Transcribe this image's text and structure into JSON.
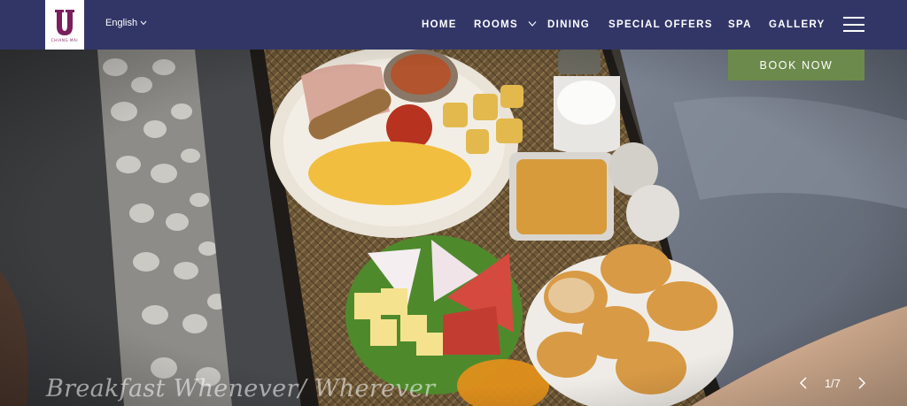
{
  "header": {
    "logo_subtext": "CHIANG MAI",
    "language": "English",
    "nav": {
      "home": "HOME",
      "rooms": "ROOMS",
      "dining": "DINING",
      "special_offers": "SPECIAL OFFERS",
      "spa": "SPA",
      "gallery": "GALLERY"
    }
  },
  "hero": {
    "book_now": "BOOK NOW",
    "caption": "Breakfast Whenever/ Wherever",
    "slide_counter": "1/7"
  },
  "colors": {
    "header_bg": "#323667",
    "book_button": "#6c8a4b",
    "logo_accent": "#7a1f5c"
  },
  "icons": [
    "u-logo-mark",
    "chevron-down-icon",
    "menu-icon",
    "chevron-left-icon",
    "chevron-right-icon"
  ]
}
